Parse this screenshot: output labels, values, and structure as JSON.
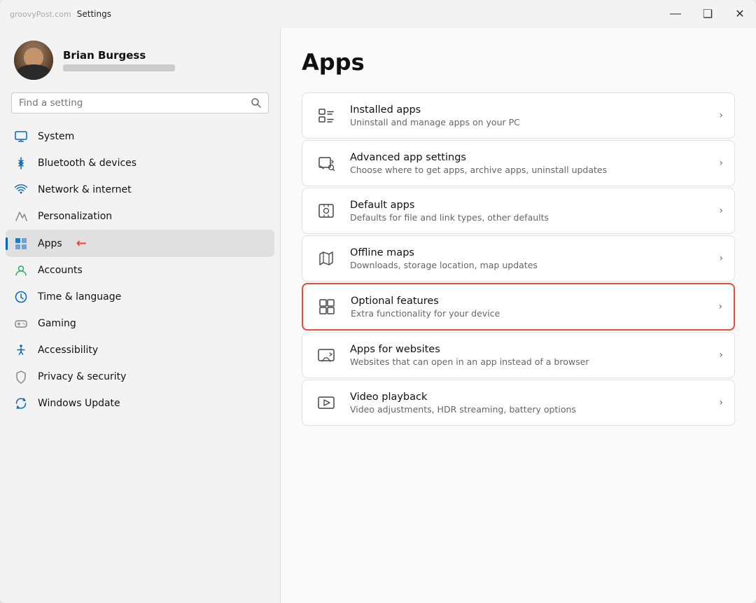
{
  "window": {
    "title": "Settings",
    "watermark": "groovyPost.com",
    "controls": {
      "minimize": "—",
      "maximize": "❑",
      "close": "✕"
    }
  },
  "sidebar": {
    "user": {
      "name": "Brian Burgess",
      "email_placeholder": ""
    },
    "search": {
      "placeholder": "Find a setting"
    },
    "nav_items": [
      {
        "id": "system",
        "label": "System",
        "icon": "system"
      },
      {
        "id": "bluetooth",
        "label": "Bluetooth & devices",
        "icon": "bluetooth"
      },
      {
        "id": "network",
        "label": "Network & internet",
        "icon": "network"
      },
      {
        "id": "personalization",
        "label": "Personalization",
        "icon": "personalization"
      },
      {
        "id": "apps",
        "label": "Apps",
        "icon": "apps",
        "active": true
      },
      {
        "id": "accounts",
        "label": "Accounts",
        "icon": "accounts"
      },
      {
        "id": "time",
        "label": "Time & language",
        "icon": "time"
      },
      {
        "id": "gaming",
        "label": "Gaming",
        "icon": "gaming"
      },
      {
        "id": "accessibility",
        "label": "Accessibility",
        "icon": "accessibility"
      },
      {
        "id": "privacy",
        "label": "Privacy & security",
        "icon": "privacy"
      },
      {
        "id": "update",
        "label": "Windows Update",
        "icon": "update"
      }
    ]
  },
  "content": {
    "title": "Apps",
    "items": [
      {
        "id": "installed-apps",
        "title": "Installed apps",
        "description": "Uninstall and manage apps on your PC",
        "highlighted": false
      },
      {
        "id": "advanced-app-settings",
        "title": "Advanced app settings",
        "description": "Choose where to get apps, archive apps, uninstall updates",
        "highlighted": false
      },
      {
        "id": "default-apps",
        "title": "Default apps",
        "description": "Defaults for file and link types, other defaults",
        "highlighted": false
      },
      {
        "id": "offline-maps",
        "title": "Offline maps",
        "description": "Downloads, storage location, map updates",
        "highlighted": false
      },
      {
        "id": "optional-features",
        "title": "Optional features",
        "description": "Extra functionality for your device",
        "highlighted": true
      },
      {
        "id": "apps-for-websites",
        "title": "Apps for websites",
        "description": "Websites that can open in an app instead of a browser",
        "highlighted": false
      },
      {
        "id": "video-playback",
        "title": "Video playback",
        "description": "Video adjustments, HDR streaming, battery options",
        "highlighted": false
      }
    ]
  }
}
